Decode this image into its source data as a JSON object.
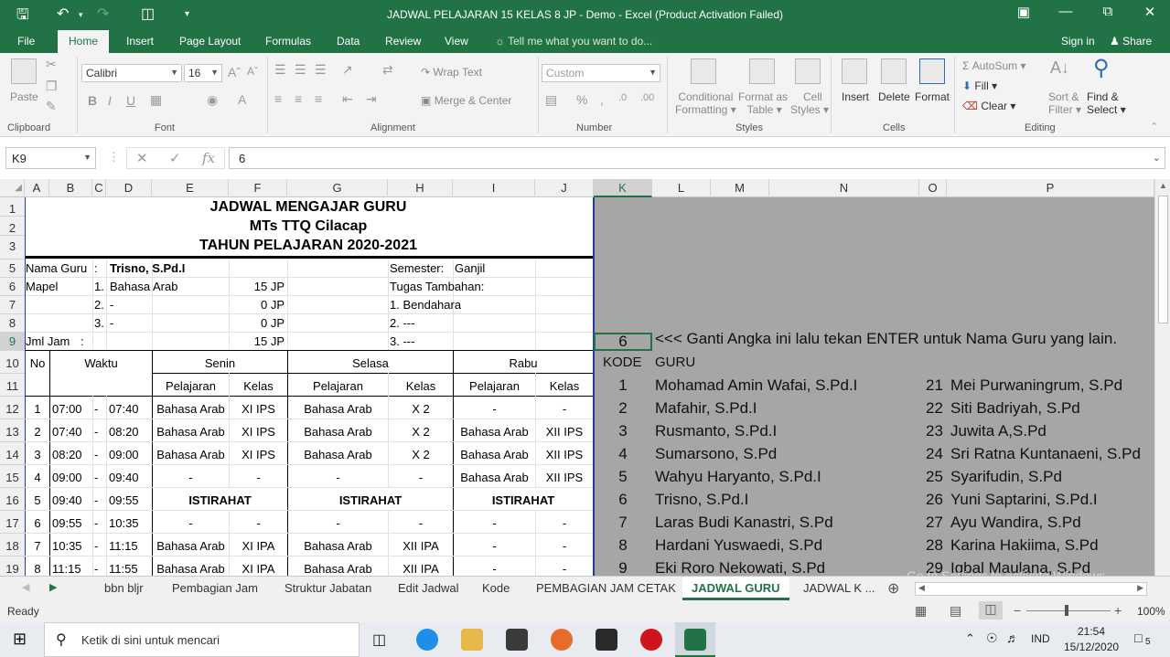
{
  "window": {
    "title": "JADWAL PELAJARAN 15 KELAS 8 JP - Demo - Excel (Product Activation Failed)"
  },
  "ribbon_tabs": [
    "File",
    "Home",
    "Insert",
    "Page Layout",
    "Formulas",
    "Data",
    "Review",
    "View"
  ],
  "tell_me": "Tell me what you want to do...",
  "sign_in": "Sign in",
  "share": "Share",
  "ribbon": {
    "paste": "Paste",
    "font_name": "Calibri",
    "font_size": "16",
    "wrap_text": "Wrap Text",
    "merge_center": "Merge & Center",
    "number_format": "Custom",
    "cond_fmt_1": "Conditional",
    "cond_fmt_2": "Formatting",
    "fmt_table_1": "Format as",
    "fmt_table_2": "Table",
    "cell_styles_1": "Cell",
    "cell_styles_2": "Styles",
    "insert": "Insert",
    "delete": "Delete",
    "format": "Format",
    "autosum": "AutoSum",
    "fill": "Fill",
    "clear": "Clear",
    "sort_1": "Sort &",
    "sort_2": "Filter",
    "find_1": "Find &",
    "find_2": "Select",
    "groups": [
      "Clipboard",
      "Font",
      "Alignment",
      "Number",
      "Styles",
      "Cells",
      "Editing"
    ]
  },
  "formula_bar": {
    "name_box": "K9",
    "formula": "6"
  },
  "columns": [
    "A",
    "B",
    "C",
    "D",
    "E",
    "F",
    "G",
    "H",
    "I",
    "J",
    "K",
    "L",
    "M",
    "N",
    "O",
    "P"
  ],
  "rows": [
    "1",
    "2",
    "3",
    "5",
    "6",
    "7",
    "8",
    "9",
    "10",
    "11",
    "12",
    "13",
    "14",
    "15",
    "16",
    "17",
    "18",
    "19"
  ],
  "sheet": {
    "title1": "JADWAL MENGAJAR GURU",
    "title2": "MTs TTQ Cilacap",
    "title3": "TAHUN PELAJARAN 2020-2021",
    "nama_guru_label": "Nama Guru",
    "colon": ":",
    "nama_guru": "Trisno, S.Pd.I",
    "semester_label": "Semester:",
    "semester": "Ganjil",
    "mapel_label": "Mapel",
    "mapel": [
      {
        "no": "1.",
        "name": "Bahasa Arab",
        "jp": "15 JP"
      },
      {
        "no": "2.",
        "name": "-",
        "jp": "0 JP"
      },
      {
        "no": "3.",
        "name": "-",
        "jp": "0 JP"
      }
    ],
    "tugas_label": "Tugas Tambahan:",
    "tugas": [
      "1. Bendahara",
      "2. ---",
      "3. ---"
    ],
    "jml_jam_label": "Jml Jam",
    "jml_jam_colon": ":",
    "jml_jam": "15 JP",
    "hdr_no": "No",
    "hdr_waktu": "Waktu",
    "days": [
      "Senin",
      "Selasa",
      "Rabu"
    ],
    "hdr_pelajaran": "Pelajaran",
    "hdr_kelas": "Kelas",
    "dash": "-",
    "schedule": [
      {
        "no": "1",
        "start": "07:00",
        "end": "07:40",
        "c": [
          "Bahasa Arab",
          "XI IPS",
          "Bahasa Arab",
          "X 2",
          "-",
          "-"
        ]
      },
      {
        "no": "2",
        "start": "07:40",
        "end": "08:20",
        "c": [
          "Bahasa Arab",
          "XI IPS",
          "Bahasa Arab",
          "X 2",
          "Bahasa Arab",
          "XII IPS"
        ]
      },
      {
        "no": "3",
        "start": "08:20",
        "end": "09:00",
        "c": [
          "Bahasa Arab",
          "XI IPS",
          "Bahasa Arab",
          "X 2",
          "Bahasa Arab",
          "XII IPS"
        ]
      },
      {
        "no": "4",
        "start": "09:00",
        "end": "09:40",
        "c": [
          "-",
          "-",
          "-",
          "-",
          "Bahasa Arab",
          "XII IPS"
        ]
      },
      {
        "no": "5",
        "start": "09:40",
        "end": "09:55",
        "c": [
          "ISTIRAHAT",
          "ISTIRAHAT",
          "ISTIRAHAT"
        ]
      },
      {
        "no": "6",
        "start": "09:55",
        "end": "10:35",
        "c": [
          "-",
          "-",
          "-",
          "-",
          "-",
          "-"
        ]
      },
      {
        "no": "7",
        "start": "10:35",
        "end": "11:15",
        "c": [
          "Bahasa Arab",
          "XI IPA",
          "Bahasa Arab",
          "XII IPA",
          "-",
          "-"
        ]
      },
      {
        "no": "8",
        "start": "11:15",
        "end": "11:55",
        "c": [
          "Bahasa Arab",
          "XI IPA",
          "Bahasa Arab",
          "XII IPA",
          "-",
          "-"
        ]
      }
    ],
    "k9_value": "6",
    "instruction": "<<< Ganti Angka ini lalu tekan ENTER untuk Nama Guru yang lain.",
    "kode_label": "KODE",
    "guru_label": "GURU",
    "teachers_left": [
      {
        "k": "1",
        "n": "Mohamad Amin Wafai, S.Pd.I"
      },
      {
        "k": "2",
        "n": "Mafahir, S.Pd.I"
      },
      {
        "k": "3",
        "n": "Rusmanto, S.Pd.I"
      },
      {
        "k": "4",
        "n": "Sumarsono, S.Pd"
      },
      {
        "k": "5",
        "n": "Wahyu Haryanto, S.Pd.I"
      },
      {
        "k": "6",
        "n": "Trisno, S.Pd.I"
      },
      {
        "k": "7",
        "n": "Laras Budi Kanastri, S.Pd"
      },
      {
        "k": "8",
        "n": "Hardani Yuswaedi, S.Pd"
      },
      {
        "k": "9",
        "n": "Eki Roro Nekowati, S.Pd"
      }
    ],
    "teachers_right": [
      {
        "k": "21",
        "n": "Mei Purwaningrum, S.Pd"
      },
      {
        "k": "22",
        "n": "Siti Badriyah, S.Pd"
      },
      {
        "k": "23",
        "n": "Juwita A,S.Pd"
      },
      {
        "k": "24",
        "n": "Sri Ratna Kuntanaeni, S.Pd"
      },
      {
        "k": "25",
        "n": "Syarifudin, S.Pd"
      },
      {
        "k": "26",
        "n": "Yuni Saptarini, S.Pd.I"
      },
      {
        "k": "27",
        "n": "Ayu Wandira, S.Pd"
      },
      {
        "k": "28",
        "n": "Karina Hakiima, S.Pd"
      },
      {
        "k": "29",
        "n": "Iqbal Maulana, S.Pd"
      }
    ]
  },
  "sheet_tabs": [
    "bbn bljr",
    "Pembagian Jam",
    "Struktur Jabatan",
    "Edit Jadwal",
    "Kode",
    "PEMBAGIAN JAM CETAK",
    "JADWAL GURU",
    "JADWAL K ..."
  ],
  "activate_watermark": "Go to Settings to activate Windows.",
  "status": {
    "ready": "Ready",
    "zoom": "100%"
  },
  "taskbar": {
    "search_placeholder": "Ketik di sini untuk mencari",
    "lang": "IND",
    "time": "21:54",
    "date": "15/12/2020",
    "notif_count": "5"
  },
  "colors": {
    "excel_green": "#217346",
    "gray_area": "#a6a6a6"
  }
}
